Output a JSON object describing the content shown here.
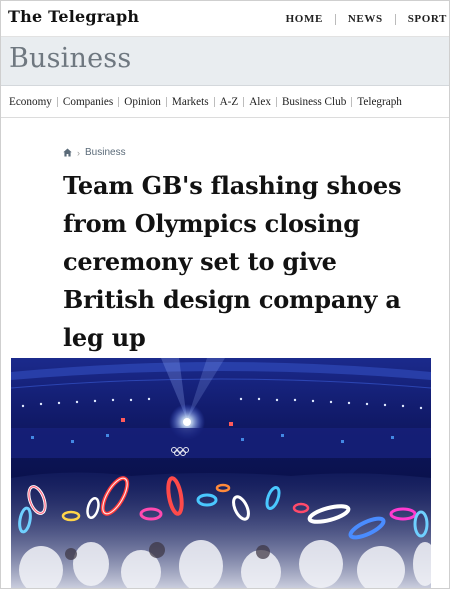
{
  "site": {
    "logo": "The Telegraph",
    "top_nav": [
      "HOME",
      "NEWS",
      "SPORT"
    ]
  },
  "section": {
    "title": "Business"
  },
  "section_nav": [
    "Economy",
    "Companies",
    "Opinion",
    "Markets",
    "A-Z",
    "Alex",
    "Business Club",
    "Telegraph"
  ],
  "breadcrumb": {
    "home_icon": "home-icon",
    "label": "Business"
  },
  "article": {
    "headline": "Team GB's flashing shoes from Olympics closing ceremony set to give British design company a leg up",
    "hero_image": "stadium-crowd-flashing-lights"
  },
  "colors": {
    "banner_bg": "#e9edf0",
    "banner_text": "#6f7880",
    "breadcrumb_text": "#5a6a78",
    "hero_blue": "#0a1250"
  }
}
